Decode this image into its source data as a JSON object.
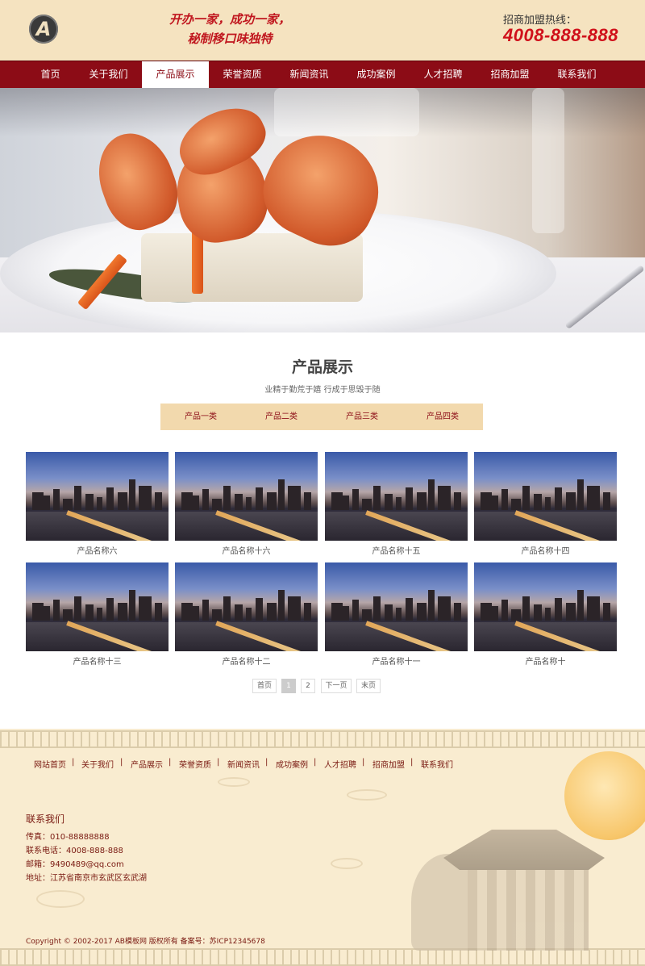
{
  "header": {
    "logo_letter": "A",
    "slogan_line1": "开办一家，成功一家，",
    "slogan_line2": "秘制移口味独特",
    "hotline_label": "招商加盟热线：",
    "hotline_number": "4008-888-888"
  },
  "nav": {
    "items": [
      {
        "label": "首页"
      },
      {
        "label": "关于我们"
      },
      {
        "label": "产品展示",
        "active": true
      },
      {
        "label": "荣誉资质"
      },
      {
        "label": "新闻资讯"
      },
      {
        "label": "成功案例"
      },
      {
        "label": "人才招聘"
      },
      {
        "label": "招商加盟"
      },
      {
        "label": "联系我们"
      }
    ]
  },
  "section": {
    "title": "产品展示",
    "subtitle": "业精于勤荒于嬉 行成于思毁于随"
  },
  "categories": [
    "产品一类",
    "产品二类",
    "产品三类",
    "产品四类"
  ],
  "products": [
    {
      "name": "产品名称六"
    },
    {
      "name": "产品名称十六"
    },
    {
      "name": "产品名称十五"
    },
    {
      "name": "产品名称十四"
    },
    {
      "name": "产品名称十三"
    },
    {
      "name": "产品名称十二"
    },
    {
      "name": "产品名称十一"
    },
    {
      "name": "产品名称十"
    }
  ],
  "pager": {
    "first": "首页",
    "page1": "1",
    "page2": "2",
    "next": "下一页",
    "last": "末页",
    "current_page": 1
  },
  "footer": {
    "nav": [
      "网站首页",
      "关于我们",
      "产品展示",
      "荣誉资质",
      "新闻资讯",
      "成功案例",
      "人才招聘",
      "招商加盟",
      "联系我们"
    ],
    "separator": "|",
    "contact_title": "联系我们",
    "fax": "传真：010-88888888",
    "phone": "联系电话：4008-888-888",
    "email": "邮箱：9490489@qq.com",
    "address": "地址：江苏省南京市玄武区玄武湖",
    "copyright": "Copyright © 2002-2017 AB模板网 版权所有 备案号：苏ICP12345678"
  },
  "colors": {
    "header_bg": "#f5e3c0",
    "nav_bg": "#8c0c16",
    "accent_red": "#d0101a",
    "category_bar": "#f2d9ad",
    "footer_bg": "#f9ecd0"
  }
}
